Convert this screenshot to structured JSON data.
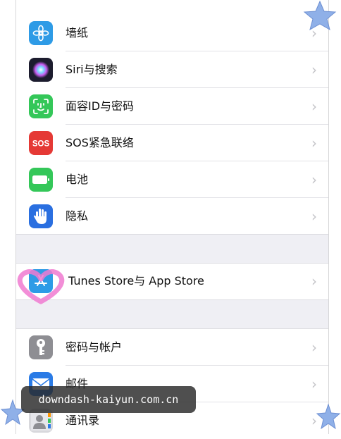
{
  "settings": {
    "items": [
      {
        "label": "墙纸",
        "icon": "wallpaper-flower-icon",
        "color": "#2e9be6"
      },
      {
        "label": "Siri与搜索",
        "icon": "siri-icon",
        "color": "#1c1c2e"
      },
      {
        "label": "面容ID与密码",
        "icon": "face-id-icon",
        "color": "#34c759"
      },
      {
        "label": "SOS紧急联络",
        "icon": "sos-icon",
        "color": "#e53935"
      },
      {
        "label": "电池",
        "icon": "battery-icon",
        "color": "#34c759"
      },
      {
        "label": "隐私",
        "icon": "hand-icon",
        "color": "#2a6fe0"
      },
      {
        "label": "Tunes Store与 App Store",
        "icon": "app-store-icon",
        "color": "#2e9be6"
      },
      {
        "label": "密码与帐户",
        "icon": "key-icon",
        "color": "#8e8e93"
      },
      {
        "label": "邮件",
        "icon": "mail-icon",
        "color": "#2a7be6"
      },
      {
        "label": "通讯录",
        "icon": "contacts-icon",
        "color": "#b9b9bd"
      }
    ],
    "chevron": "›"
  },
  "watermark": {
    "text": "downdash-kaiyun.com.cn"
  },
  "colors": {
    "background": "#efeff4",
    "separator": "#e2e2e6",
    "heart": "#f07ad0",
    "star": "#8fb0e8"
  }
}
